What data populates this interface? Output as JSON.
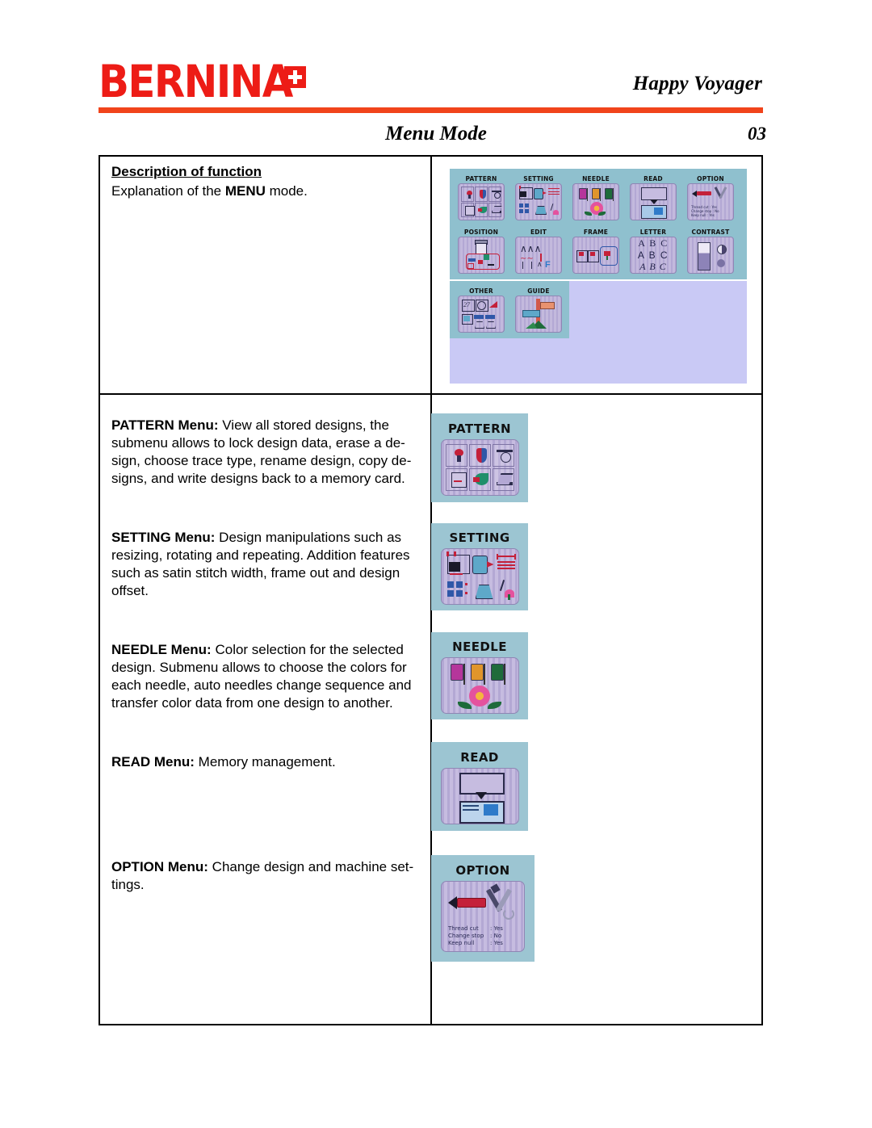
{
  "header": {
    "brand": "BERNINA",
    "brand_mark": "swiss-cross",
    "tagline": "Happy Voyager",
    "title": "Menu Mode",
    "page_number": "03",
    "rule_color": "#F1441B",
    "brand_color": "#ED1C16"
  },
  "description": {
    "heading": "Description of function",
    "body_before": "Explanation of  the ",
    "body_bold": "MENU",
    "body_after": " mode."
  },
  "menu_screen": {
    "background_color": "#8FC0CE",
    "lower_background_color": "#C9C9F5",
    "row1": [
      {
        "label": "PATTERN"
      },
      {
        "label": "SETTING"
      },
      {
        "label": "NEEDLE"
      },
      {
        "label": "READ"
      },
      {
        "label": "OPTION"
      }
    ],
    "row2": [
      {
        "label": "POSITION"
      },
      {
        "label": "EDIT"
      },
      {
        "label": "FRAME"
      },
      {
        "label": "LETTER"
      },
      {
        "label": "CONTRAST"
      }
    ],
    "row3": [
      {
        "label": "OTHER"
      },
      {
        "label": "GUIDE"
      }
    ],
    "letter_samples": [
      "A B C",
      "A B C",
      "A B C"
    ],
    "option_settings": [
      {
        "name": "Thread cut",
        "value": "Yes"
      },
      {
        "name": "Change stop",
        "value": "No"
      },
      {
        "name": "Keep null",
        "value": "Yes"
      }
    ]
  },
  "paragraphs": [
    {
      "menu": "PATTERN Menu:",
      "text": " View all stored designs, the submenu allows to lock design data, erase a de-sign, choose trace type, rename design, copy de-signs, and write designs back to a memory card."
    },
    {
      "menu": "SETTING Menu:",
      "text": " Design manipulations such as resizing, rotating and repeating. Addition features such as satin stitch width, frame out and design offset."
    },
    {
      "menu": "NEEDLE Menu:",
      "text": " Color selection for the selected design. Submenu  allows to choose the colors for each needle, auto needles change sequence and transfer color data from one design to another."
    },
    {
      "menu": "READ Menu:",
      "text": " Memory management."
    },
    {
      "menu": "OPTION Menu:",
      "text": " Change design and machine set-tings."
    }
  ],
  "panels": [
    {
      "label": "PATTERN"
    },
    {
      "label": "SETTING"
    },
    {
      "label": "NEEDLE"
    },
    {
      "label": "READ"
    },
    {
      "label": "OPTION"
    }
  ]
}
